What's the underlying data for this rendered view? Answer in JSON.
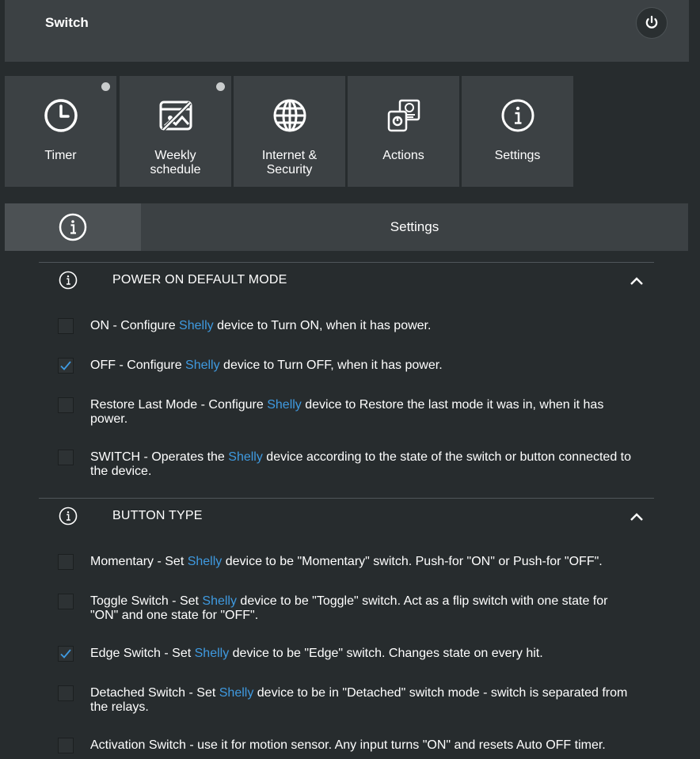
{
  "header": {
    "title": "Switch"
  },
  "tiles": [
    {
      "label": "Timer",
      "icon": "clock-icon",
      "has_dot": true
    },
    {
      "label": "Weekly\nschedule",
      "icon": "schedule-icon",
      "has_dot": true
    },
    {
      "label": "Internet &\nSecurity",
      "icon": "globe-icon",
      "has_dot": false
    },
    {
      "label": "Actions",
      "icon": "actions-icon",
      "has_dot": false
    },
    {
      "label": "Settings",
      "icon": "info-icon",
      "has_dot": false
    }
  ],
  "tabbar": {
    "title": "Settings"
  },
  "sections": [
    {
      "title": "POWER ON DEFAULT MODE",
      "options": [
        {
          "pre": "ON - Configure ",
          "brand": "Shelly",
          "post": " device to Turn ON, when it has power.",
          "checked": false
        },
        {
          "pre": "OFF - Configure ",
          "brand": "Shelly",
          "post": " device to Turn OFF, when it has power.",
          "checked": true
        },
        {
          "pre": "Restore Last Mode - Configure ",
          "brand": "Shelly",
          "post": " device to Restore the last mode it was in, when it has power.",
          "checked": false
        },
        {
          "pre": "SWITCH - Operates the ",
          "brand": "Shelly",
          "post": " device according to the state of the switch or button connected to the device.",
          "checked": false
        }
      ]
    },
    {
      "title": "BUTTON TYPE",
      "options": [
        {
          "pre": "Momentary - Set ",
          "brand": "Shelly",
          "post": " device to be \"Momentary\" switch. Push-for \"ON\" or Push-for \"OFF\".",
          "checked": false
        },
        {
          "pre": "Toggle Switch - Set ",
          "brand": "Shelly",
          "post": " device to be \"Toggle\" switch. Act as a flip switch with one state for \"ON\" and one state for \"OFF\".",
          "checked": false
        },
        {
          "pre": "Edge Switch - Set ",
          "brand": "Shelly",
          "post": " device to be \"Edge\" switch. Changes state on every hit.",
          "checked": true
        },
        {
          "pre": "Detached Switch - Set ",
          "brand": "Shelly",
          "post": " device to be in \"Detached\" switch mode - switch is separated from the relays.",
          "checked": false
        },
        {
          "pre": "Activation Switch - use it for motion sensor. Any input turns \"ON\" and resets Auto OFF timer.",
          "brand": "",
          "post": "",
          "checked": false
        }
      ]
    }
  ],
  "colors": {
    "brand_link": "#3f9ae0",
    "checkmark": "#3f9ae0",
    "panel": "#3c4144",
    "background": "#272c2e"
  }
}
